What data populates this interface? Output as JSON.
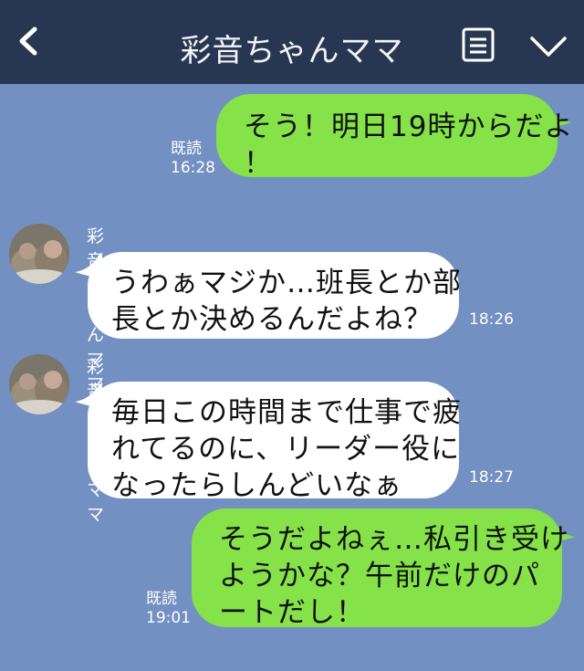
{
  "header": {
    "title": "彩音ちゃんママ",
    "back_icon": "chevron-left-icon",
    "menu_icon": "menu-list-icon",
    "expand_icon": "chevron-down-icon"
  },
  "colors": {
    "header_bg": "#283751",
    "chat_bg": "#7290c2",
    "outgoing_bubble": "#85e249",
    "incoming_bubble": "#ffffff"
  },
  "messages": [
    {
      "direction": "outgoing",
      "lines": [
        "そう！明日19時からだよ",
        "！"
      ],
      "read_label": "既読",
      "time": "16:28"
    },
    {
      "direction": "incoming",
      "sender": "彩音ちゃんママ",
      "lines": [
        "うわぁマジか…班長とか部",
        "長とか決めるんだよね？"
      ],
      "time": "18:26"
    },
    {
      "direction": "incoming",
      "sender": "彩音ちゃんママ",
      "lines": [
        "毎日この時間まで仕事で疲",
        "れてるのに、リーダー役に",
        "なったらしんどいなぁ"
      ],
      "time": "18:27"
    },
    {
      "direction": "outgoing",
      "lines": [
        "そうだよねぇ…私引き受け",
        "ようかな？午前だけのパ",
        "ートだし！"
      ],
      "read_label": "既読",
      "time": "19:01"
    }
  ]
}
